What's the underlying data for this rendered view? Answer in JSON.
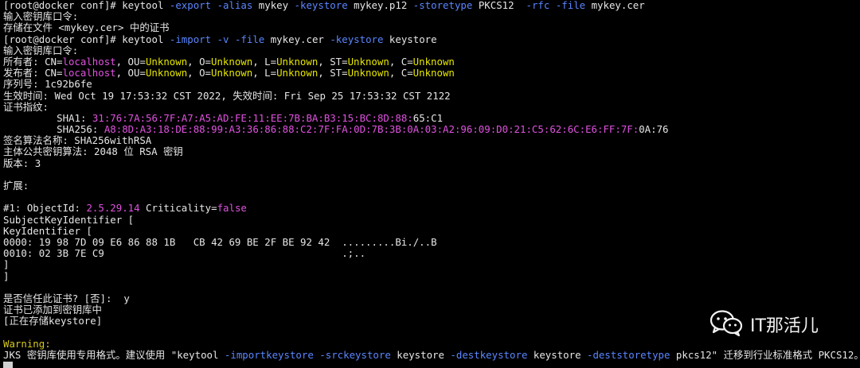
{
  "colors": {
    "background": "#000000",
    "text": "#e6e6e6",
    "option": "#5a86ff",
    "highlight": "#e052e0",
    "name_value": "#e6e600",
    "warning": "#d7c81e"
  },
  "terminal": {
    "lines": [
      {
        "segments": [
          {
            "t": "[root@docker conf]# keytool ",
            "c": "w"
          },
          {
            "t": "-export",
            "c": "b"
          },
          {
            "t": " ",
            "c": "w"
          },
          {
            "t": "-alias",
            "c": "b"
          },
          {
            "t": " mykey ",
            "c": "w"
          },
          {
            "t": "-keystore",
            "c": "b"
          },
          {
            "t": " mykey.p12 ",
            "c": "w"
          },
          {
            "t": "-storetype",
            "c": "b"
          },
          {
            "t": " PKCS12  ",
            "c": "w"
          },
          {
            "t": "-rfc",
            "c": "b"
          },
          {
            "t": " ",
            "c": "w"
          },
          {
            "t": "-file",
            "c": "b"
          },
          {
            "t": " mykey.cer",
            "c": "w"
          }
        ]
      },
      {
        "segments": [
          {
            "t": "输入密钥库口令:",
            "c": "w"
          }
        ]
      },
      {
        "segments": [
          {
            "t": "存储在文件 <mykey.cer> 中的证书",
            "c": "w"
          }
        ]
      },
      {
        "segments": [
          {
            "t": "[root@docker conf]# keytool ",
            "c": "w"
          },
          {
            "t": "-import",
            "c": "b"
          },
          {
            "t": " ",
            "c": "w"
          },
          {
            "t": "-v",
            "c": "b"
          },
          {
            "t": " ",
            "c": "w"
          },
          {
            "t": "-file",
            "c": "b"
          },
          {
            "t": " mykey.cer ",
            "c": "w"
          },
          {
            "t": "-keystore",
            "c": "b"
          },
          {
            "t": " keystore",
            "c": "w"
          }
        ]
      },
      {
        "segments": [
          {
            "t": "输入密钥库口令:",
            "c": "w"
          }
        ]
      },
      {
        "segments": [
          {
            "t": "所有者: CN=",
            "c": "w"
          },
          {
            "t": "localhost",
            "c": "m"
          },
          {
            "t": ", OU=",
            "c": "w"
          },
          {
            "t": "Unknown",
            "c": "y"
          },
          {
            "t": ", O=",
            "c": "w"
          },
          {
            "t": "Unknown",
            "c": "y"
          },
          {
            "t": ", L=",
            "c": "w"
          },
          {
            "t": "Unknown",
            "c": "y"
          },
          {
            "t": ", ST=",
            "c": "w"
          },
          {
            "t": "Unknown",
            "c": "y"
          },
          {
            "t": ", C=",
            "c": "w"
          },
          {
            "t": "Unknown",
            "c": "y"
          }
        ]
      },
      {
        "segments": [
          {
            "t": "发布者: CN=",
            "c": "w"
          },
          {
            "t": "localhost",
            "c": "m"
          },
          {
            "t": ", OU=",
            "c": "w"
          },
          {
            "t": "Unknown",
            "c": "y"
          },
          {
            "t": ", O=",
            "c": "w"
          },
          {
            "t": "Unknown",
            "c": "y"
          },
          {
            "t": ", L=",
            "c": "w"
          },
          {
            "t": "Unknown",
            "c": "y"
          },
          {
            "t": ", ST=",
            "c": "w"
          },
          {
            "t": "Unknown",
            "c": "y"
          },
          {
            "t": ", C=",
            "c": "w"
          },
          {
            "t": "Unknown",
            "c": "y"
          }
        ]
      },
      {
        "segments": [
          {
            "t": "序列号: 1c92b6fe",
            "c": "w"
          }
        ]
      },
      {
        "segments": [
          {
            "t": "生效时间: Wed Oct 19 17:53:32 CST 2022, 失效时间: Fri Sep 25 17:53:32 CST 2122",
            "c": "w"
          }
        ]
      },
      {
        "segments": [
          {
            "t": "证书指纹:",
            "c": "w"
          }
        ]
      },
      {
        "segments": [
          {
            "t": "         SHA1: ",
            "c": "w"
          },
          {
            "t": "31:76:7A:56:7F:A7:A5:AD:FE:11:EE:7B:BA:B3:15:BC:8D:88:",
            "c": "m"
          },
          {
            "t": "65:C1",
            "c": "w"
          }
        ]
      },
      {
        "segments": [
          {
            "t": "         SHA256: ",
            "c": "w"
          },
          {
            "t": "A8:8D:A3:18:DE:88:99:A3:36:86:88:C2:7F:FA:0D:7B:3B:0A:03:A2:96:09:D0:21:C5:62:6C:E6:FF:7F:",
            "c": "m"
          },
          {
            "t": "0A:76",
            "c": "w"
          }
        ]
      },
      {
        "segments": [
          {
            "t": "签名算法名称: SHA256withRSA",
            "c": "w"
          }
        ]
      },
      {
        "segments": [
          {
            "t": "主体公共密钥算法: 2048 位 RSA 密钥",
            "c": "w"
          }
        ]
      },
      {
        "segments": [
          {
            "t": "版本: 3",
            "c": "w"
          }
        ]
      },
      {
        "segments": [
          {
            "t": "",
            "c": "w"
          }
        ]
      },
      {
        "segments": [
          {
            "t": "扩展:",
            "c": "w"
          }
        ]
      },
      {
        "segments": [
          {
            "t": "",
            "c": "w"
          }
        ]
      },
      {
        "segments": [
          {
            "t": "#1: ObjectId: ",
            "c": "w"
          },
          {
            "t": "2.5.29.14",
            "c": "m"
          },
          {
            "t": " Criticality=",
            "c": "w"
          },
          {
            "t": "false",
            "c": "m"
          }
        ]
      },
      {
        "segments": [
          {
            "t": "SubjectKeyIdentifier [",
            "c": "w"
          }
        ]
      },
      {
        "segments": [
          {
            "t": "KeyIdentifier [",
            "c": "w"
          }
        ]
      },
      {
        "segments": [
          {
            "t": "0000: 19 98 7D 09 E6 86 88 1B   CB 42 69 BE 2F BE 92 42  .........Bi./..B",
            "c": "w"
          }
        ]
      },
      {
        "segments": [
          {
            "t": "0010: 02 3B 7E C9                                        .;..",
            "c": "w"
          }
        ]
      },
      {
        "segments": [
          {
            "t": "]",
            "c": "w"
          }
        ]
      },
      {
        "segments": [
          {
            "t": "]",
            "c": "w"
          }
        ]
      },
      {
        "segments": [
          {
            "t": "",
            "c": "w"
          }
        ]
      },
      {
        "segments": [
          {
            "t": "是否信任此证书? [否]:  y",
            "c": "w"
          }
        ]
      },
      {
        "segments": [
          {
            "t": "证书已添加到密钥库中",
            "c": "w"
          }
        ]
      },
      {
        "segments": [
          {
            "t": "[正在存储keystore]",
            "c": "w"
          }
        ]
      },
      {
        "segments": [
          {
            "t": "",
            "c": "w"
          }
        ]
      },
      {
        "segments": [
          {
            "t": "Warning:",
            "c": "wy"
          }
        ]
      },
      {
        "segments": [
          {
            "t": "JKS 密钥库使用专用格式。建议使用 \"keytool ",
            "c": "w"
          },
          {
            "t": "-importkeystore",
            "c": "b"
          },
          {
            "t": " ",
            "c": "w"
          },
          {
            "t": "-srckeystore",
            "c": "b"
          },
          {
            "t": " keystore ",
            "c": "w"
          },
          {
            "t": "-destkeystore",
            "c": "b"
          },
          {
            "t": " keystore ",
            "c": "w"
          },
          {
            "t": "-deststoretype",
            "c": "b"
          },
          {
            "t": " pkcs12\" 迁移到行业标准格式 PKCS12。",
            "c": "w"
          }
        ]
      }
    ]
  },
  "watermark": {
    "icon": "wechat-icon",
    "text": "IT那活儿"
  }
}
